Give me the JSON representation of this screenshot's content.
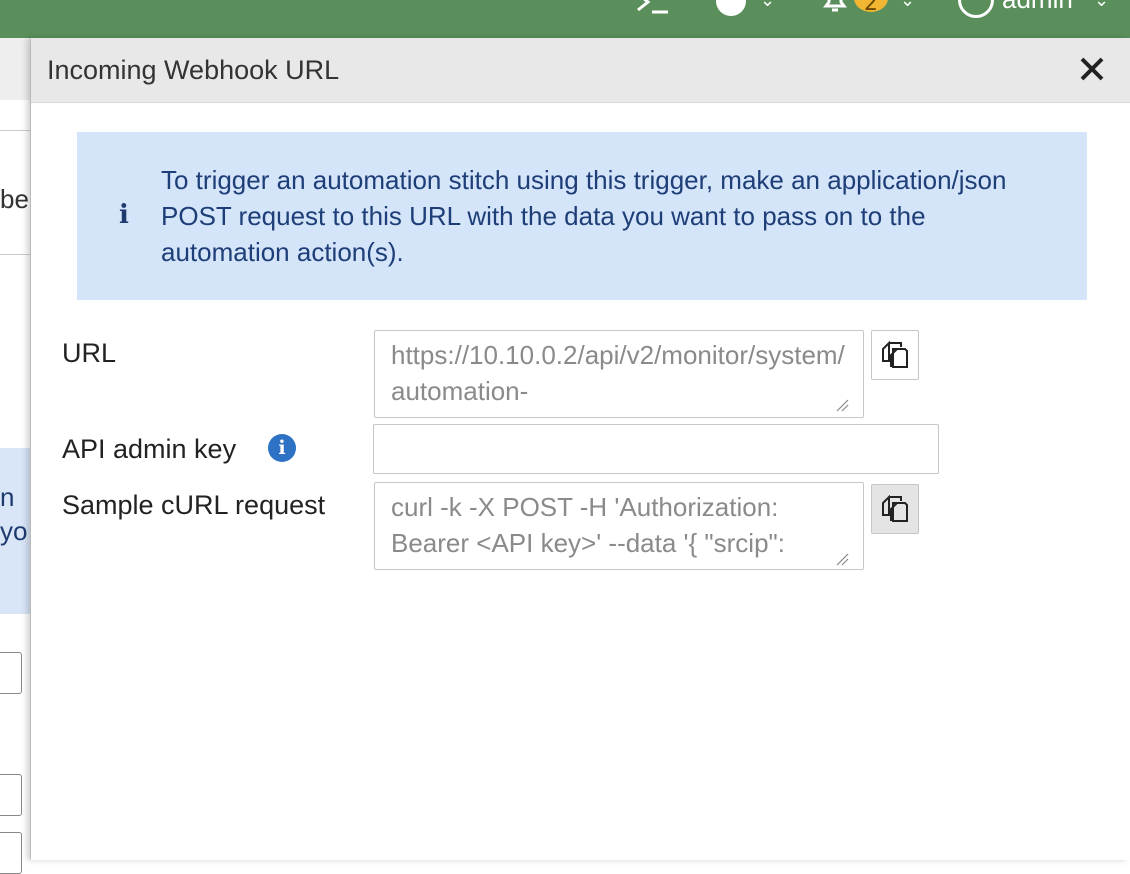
{
  "header": {
    "user": "admin",
    "notification_count": "2",
    "icons": [
      "cli-icon",
      "help-icon",
      "bell-icon",
      "user-icon"
    ]
  },
  "background_page": {
    "text_row1": "be",
    "text_row2": "n",
    "text_row3": "yo"
  },
  "panel": {
    "title": "Incoming Webhook URL",
    "info_message": "To trigger an automation stitch using this trigger, make an application/json POST request to this URL with the data you want to pass on to the automation action(s).",
    "fields": {
      "url": {
        "label": "URL",
        "value": "https://10.10.0.2/api/v2/monitor/system/automation-"
      },
      "api_key": {
        "label": "API admin key",
        "value": ""
      },
      "curl": {
        "label": "Sample cURL request",
        "value": "curl -k -X POST -H 'Authorization: Bearer <API key>' --data '{ \"srcip\":"
      }
    }
  },
  "colors": {
    "header_green": "#5a8f5c",
    "info_bg": "#d4e4f9",
    "info_text": "#1e3e78",
    "badge": "#f2b632"
  }
}
